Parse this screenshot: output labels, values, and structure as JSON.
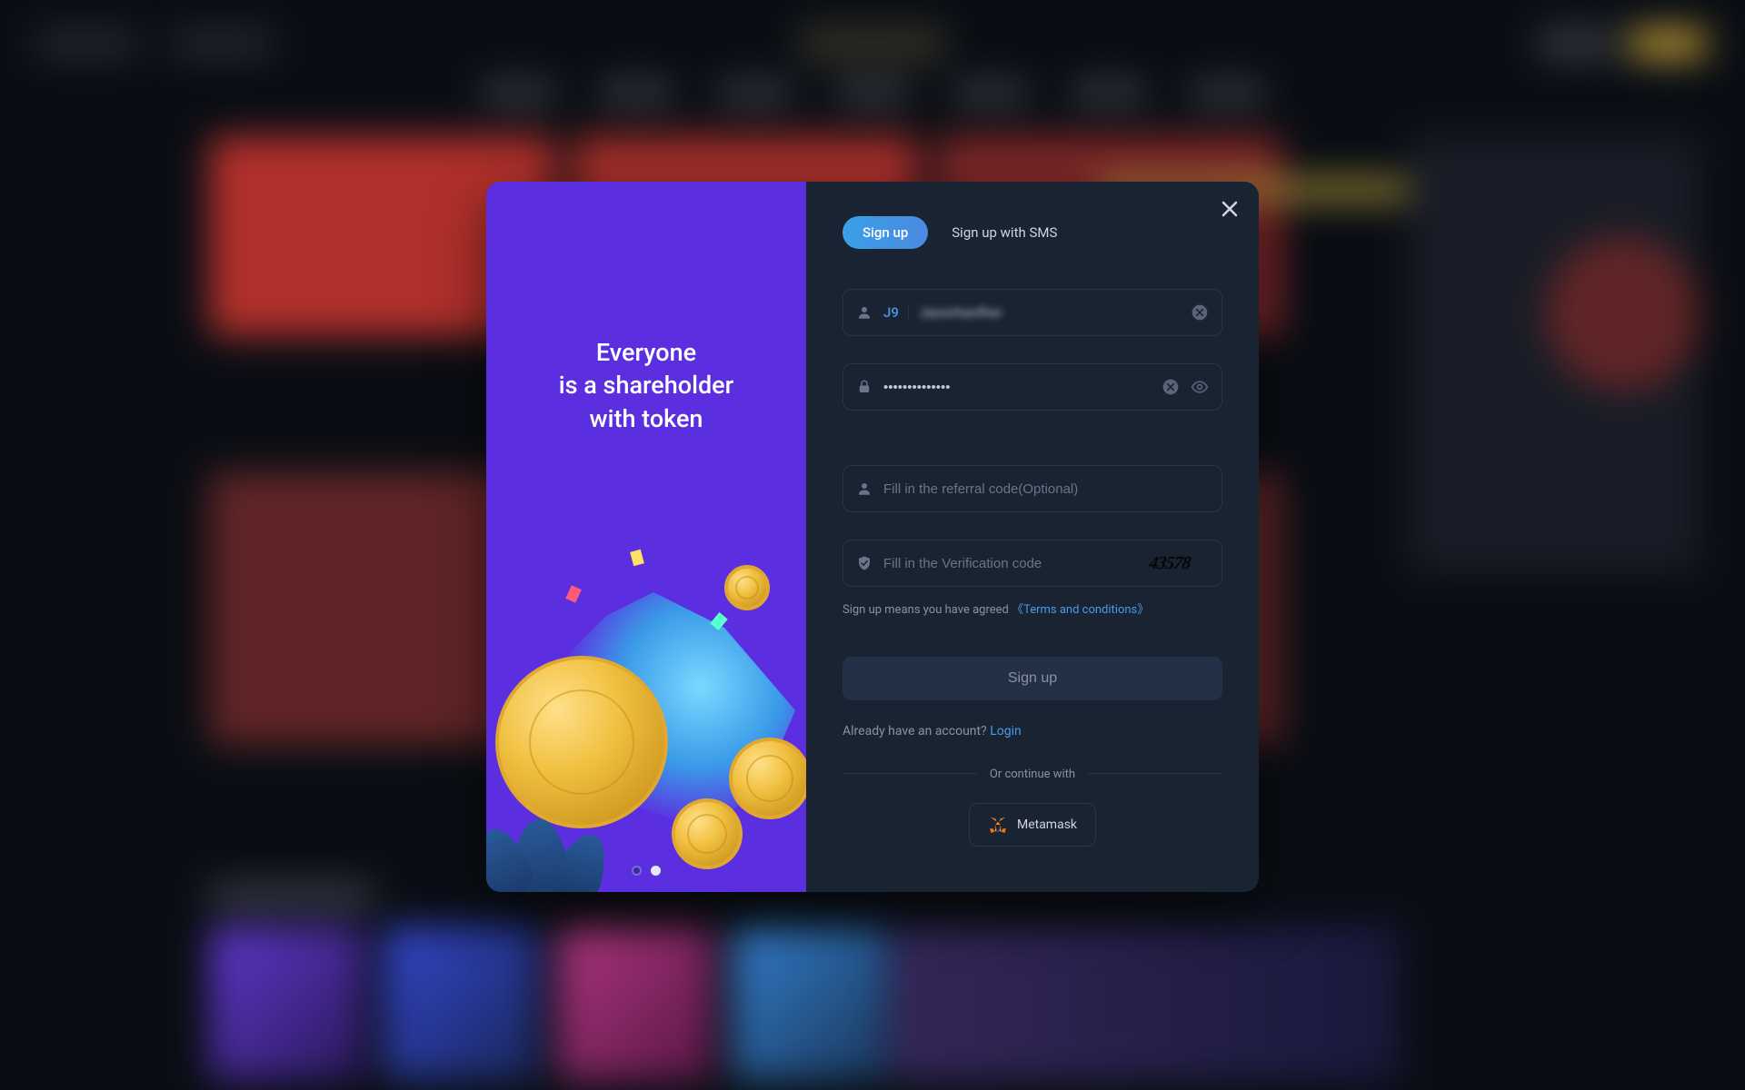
{
  "promo": {
    "line1": "Everyone",
    "line2": "is a shareholder",
    "line3": "with token"
  },
  "tabs": {
    "signup": "Sign up",
    "sms": "Sign up with SMS"
  },
  "fields": {
    "username_prefix": "J9",
    "username_value": "Jasonhanfher",
    "password_value": "••••••••••••••",
    "referral_placeholder": "Fill in the referral code(Optional)",
    "verification_placeholder": "Fill in the Verification code",
    "captcha_text": "43578"
  },
  "agree": {
    "prefix": "Sign up means you have agreed  ",
    "link": "《Terms and conditions》"
  },
  "submit_label": "Sign up",
  "have_account": {
    "prefix": "Already have an account? ",
    "login": "Login"
  },
  "continue_label": "Or continue with",
  "metamask_label": "Metamask",
  "carousel": {
    "active_index": 1,
    "total": 2
  }
}
